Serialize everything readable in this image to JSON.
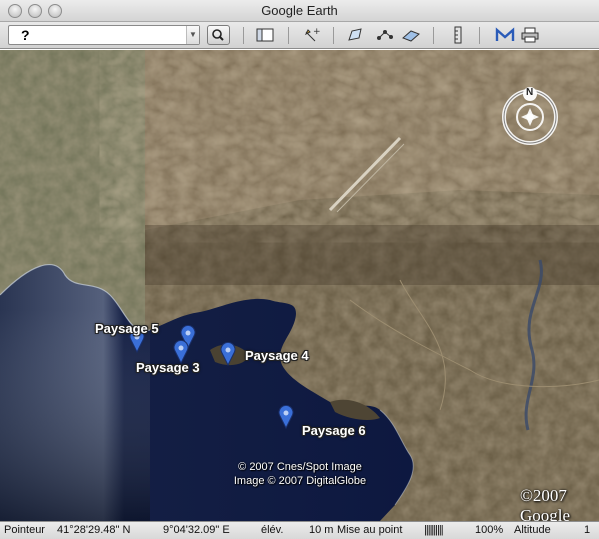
{
  "window": {
    "title": "Google Earth"
  },
  "toolbar": {
    "search_value": "?",
    "tools": [
      "sidebar-icon",
      "placemark-icon",
      "polygon-icon",
      "path-icon",
      "overlay-icon",
      "ruler-icon",
      "email-icon",
      "print-icon"
    ]
  },
  "map": {
    "placemarks": [
      {
        "name": "Paysage 5"
      },
      {
        "name": "Paysage 3"
      },
      {
        "name": "Paysage 4"
      },
      {
        "name": "Paysage 6"
      }
    ],
    "credit_line1": "© 2007 Cnes/Spot Image",
    "credit_line2": "Image © 2007 DigitalGlobe",
    "logo": "©2007 Google",
    "compass_label": "N"
  },
  "status": {
    "pointer_label": "Pointeur",
    "lat": "41°28'29.48\" N",
    "lon": "9°04'32.09\" E",
    "elev_label": "élév.",
    "elev_value": "10 m",
    "focus_label": "Mise au point",
    "progress_ticks": "||||||||||",
    "progress_percent": "100%",
    "altitude_label": "Altitude",
    "altitude_value": "1"
  },
  "colors": {
    "pin": "#3a6fd8",
    "water": "#0f1e4a",
    "land": "#6a5d44"
  }
}
